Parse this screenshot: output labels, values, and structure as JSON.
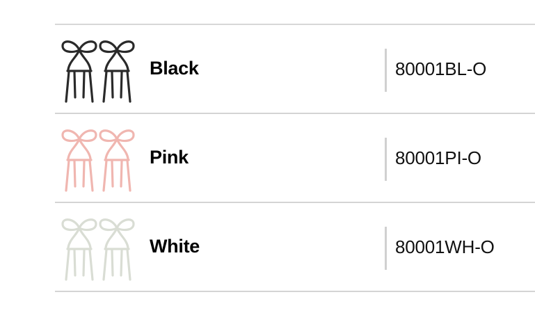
{
  "variants": [
    {
      "color": "Black",
      "sku": "80001BL-O",
      "swatch": "#2a2a2a",
      "thumb_icon": "ribbon-chair-pair-black"
    },
    {
      "color": "Pink",
      "sku": "80001PI-O",
      "swatch": "#f0b6b0",
      "thumb_icon": "ribbon-chair-pair-pink"
    },
    {
      "color": "White",
      "sku": "80001WH-O",
      "swatch": "#d9ddd4",
      "thumb_icon": "ribbon-chair-pair-white"
    }
  ]
}
